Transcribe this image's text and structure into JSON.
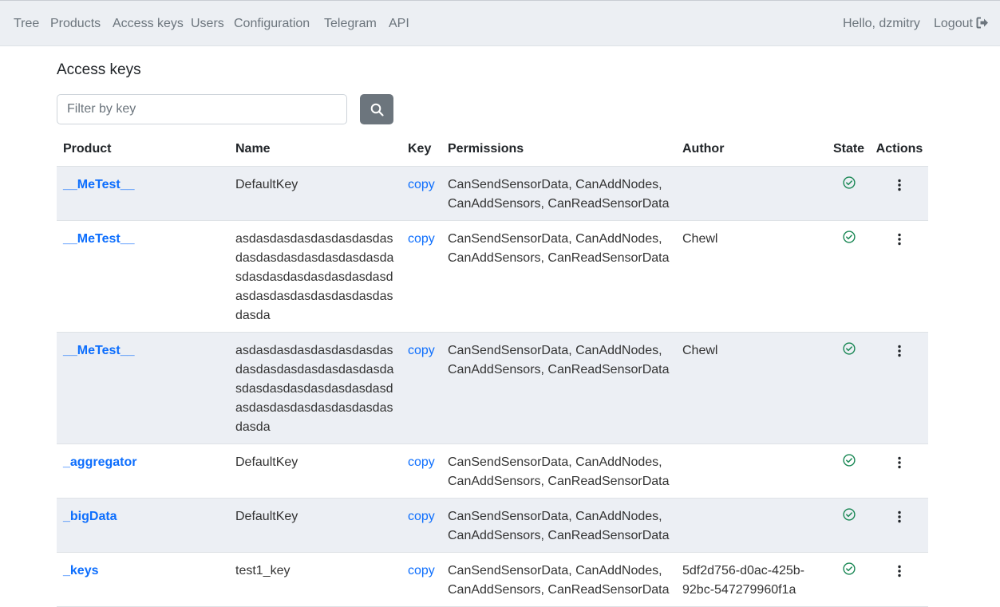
{
  "nav": {
    "items": [
      "Tree",
      "Products",
      "Access keys",
      "Users",
      "Configuration",
      "Telegram",
      "API"
    ],
    "greeting": "Hello, dzmitry",
    "logout": "Logout"
  },
  "page": {
    "title": "Access keys"
  },
  "filter": {
    "placeholder": "Filter by key",
    "value": "",
    "search_icon": "search-icon"
  },
  "table": {
    "headers": [
      "Product",
      "Name",
      "Key",
      "Permissions",
      "Author",
      "State",
      "Actions"
    ],
    "rows": [
      {
        "product": "__MeTest__",
        "name": "DefaultKey",
        "key": "copy",
        "permissions": "CanSendSensorData, CanAddNodes, CanAddSensors, CanReadSensorData",
        "author": "",
        "state": "active"
      },
      {
        "product": "__MeTest__",
        "name": "asdasdasdasdasdasdasdasdasdasdasdasdasdasdasdasdasdasdasdasdasdasdasdasdasdasdasdasdasdasdasdasda",
        "key": "copy",
        "permissions": "CanSendSensorData, CanAddNodes, CanAddSensors, CanReadSensorData",
        "author": "Chewl",
        "state": "active"
      },
      {
        "product": "__MeTest__",
        "name": "asdasdasdasdasdasdasdasdasdasdasdasdasdasdasdasdasdasdasdasdasdasdasdasdasdasdasdasdasdasdasdasda",
        "key": "copy",
        "permissions": "CanSendSensorData, CanAddNodes, CanAddSensors, CanReadSensorData",
        "author": "Chewl",
        "state": "active"
      },
      {
        "product": "_aggregator",
        "name": "DefaultKey",
        "key": "copy",
        "permissions": "CanSendSensorData, CanAddNodes, CanAddSensors, CanReadSensorData",
        "author": "",
        "state": "active"
      },
      {
        "product": "_bigData",
        "name": "DefaultKey",
        "key": "copy",
        "permissions": "CanSendSensorData, CanAddNodes, CanAddSensors, CanReadSensorData",
        "author": "",
        "state": "active"
      },
      {
        "product": "_keys",
        "name": "test1_key",
        "key": "copy",
        "permissions": "CanSendSensorData, CanAddNodes, CanAddSensors, CanReadSensorData",
        "author": "5df2d756-d0ac-425b-92bc-547279960f1a",
        "state": "active"
      }
    ]
  },
  "colors": {
    "link": "#0d6efd",
    "state_ok": "#198754",
    "navbar_bg": "#eceff3",
    "stripe_bg": "#eceff4",
    "search_button": "#6c757d"
  },
  "icons": {
    "state": "check-circle-icon",
    "actions": "kebab-menu-icon",
    "logout": "logout-icon"
  }
}
